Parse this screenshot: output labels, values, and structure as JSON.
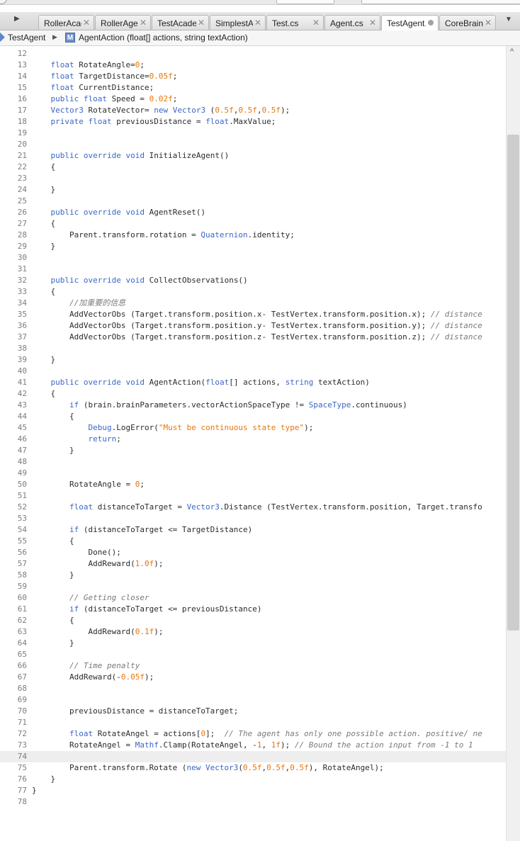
{
  "window": {
    "tabs": [
      {
        "label": "RollerAcad",
        "state": "close"
      },
      {
        "label": "RollerAger",
        "state": "close"
      },
      {
        "label": "TestAcader",
        "state": "close"
      },
      {
        "label": "SimplestAg",
        "state": "close"
      },
      {
        "label": "Test.cs",
        "state": "close"
      },
      {
        "label": "Agent.cs",
        "state": "close"
      },
      {
        "label": "TestAgent.",
        "state": "modified",
        "active": true
      },
      {
        "label": "CoreBrainI",
        "state": "close"
      }
    ],
    "close_glyph": "✕",
    "tab_left_arrow": "▶",
    "tab_dropdown": "▼"
  },
  "breadcrumb": {
    "class_name": "TestAgent",
    "separator": "▶",
    "member_icon_letter": "M",
    "member": "AgentAction (float[] actions, string textAction)"
  },
  "editor": {
    "current_line": 74,
    "lines": [
      {
        "n": "12",
        "t": ""
      },
      {
        "n": "13",
        "t": "    float RotateAngle=0;"
      },
      {
        "n": "14",
        "t": "    float TargetDistance=0.05f;"
      },
      {
        "n": "15",
        "t": "    float CurrentDistance;"
      },
      {
        "n": "16",
        "t": "    public float Speed = 0.02f;"
      },
      {
        "n": "17",
        "t": "    Vector3 RotateVector= new Vector3 (0.5f,0.5f,0.5f);"
      },
      {
        "n": "18",
        "t": "    private float previousDistance = float.MaxValue;"
      },
      {
        "n": "19",
        "t": ""
      },
      {
        "n": "20",
        "t": ""
      },
      {
        "n": "21",
        "t": "    public override void InitializeAgent()"
      },
      {
        "n": "22",
        "t": "    {"
      },
      {
        "n": "23",
        "t": ""
      },
      {
        "n": "24",
        "t": "    }"
      },
      {
        "n": "25",
        "t": ""
      },
      {
        "n": "26",
        "t": "    public override void AgentReset()"
      },
      {
        "n": "27",
        "t": "    {"
      },
      {
        "n": "28",
        "t": "        Parent.transform.rotation = Quaternion.identity;"
      },
      {
        "n": "29",
        "t": "    }"
      },
      {
        "n": "30",
        "t": ""
      },
      {
        "n": "31",
        "t": ""
      },
      {
        "n": "32",
        "t": "    public override void CollectObservations()"
      },
      {
        "n": "33",
        "t": "    {"
      },
      {
        "n": "34",
        "t": "        //加重要的信息"
      },
      {
        "n": "35",
        "t": "        AddVectorObs (Target.transform.position.x- TestVertex.transform.position.x); // distance"
      },
      {
        "n": "36",
        "t": "        AddVectorObs (Target.transform.position.y- TestVertex.transform.position.y); // distance"
      },
      {
        "n": "37",
        "t": "        AddVectorObs (Target.transform.position.z- TestVertex.transform.position.z); // distance"
      },
      {
        "n": "38",
        "t": ""
      },
      {
        "n": "39",
        "t": "    }"
      },
      {
        "n": "40",
        "t": ""
      },
      {
        "n": "41",
        "t": "    public override void AgentAction(float[] actions, string textAction)"
      },
      {
        "n": "42",
        "t": "    {"
      },
      {
        "n": "43",
        "t": "        if (brain.brainParameters.vectorActionSpaceType != SpaceType.continuous)"
      },
      {
        "n": "44",
        "t": "        {"
      },
      {
        "n": "45",
        "t": "            Debug.LogError(\"Must be continuous state type\");"
      },
      {
        "n": "46",
        "t": "            return;"
      },
      {
        "n": "47",
        "t": "        }"
      },
      {
        "n": "48",
        "t": ""
      },
      {
        "n": "49",
        "t": ""
      },
      {
        "n": "50",
        "t": "        RotateAngle = 0;"
      },
      {
        "n": "51",
        "t": ""
      },
      {
        "n": "52",
        "t": "        float distanceToTarget = Vector3.Distance (TestVertex.transform.position, Target.transfo"
      },
      {
        "n": "53",
        "t": ""
      },
      {
        "n": "54",
        "t": "        if (distanceToTarget <= TargetDistance)"
      },
      {
        "n": "55",
        "t": "        {"
      },
      {
        "n": "56",
        "t": "            Done();"
      },
      {
        "n": "57",
        "t": "            AddReward(1.0f);"
      },
      {
        "n": "58",
        "t": "        }"
      },
      {
        "n": "59",
        "t": ""
      },
      {
        "n": "60",
        "t": "        // Getting closer"
      },
      {
        "n": "61",
        "t": "        if (distanceToTarget <= previousDistance)"
      },
      {
        "n": "62",
        "t": "        {"
      },
      {
        "n": "63",
        "t": "            AddReward(0.1f);"
      },
      {
        "n": "64",
        "t": "        }"
      },
      {
        "n": "65",
        "t": ""
      },
      {
        "n": "66",
        "t": "        // Time penalty"
      },
      {
        "n": "67",
        "t": "        AddReward(-0.05f);"
      },
      {
        "n": "68",
        "t": ""
      },
      {
        "n": "69",
        "t": ""
      },
      {
        "n": "70",
        "t": "        previousDistance = distanceToTarget;"
      },
      {
        "n": "71",
        "t": ""
      },
      {
        "n": "72",
        "t": "        float RotateAngel = actions[0];  // The agent has only one possible action. positive/ ne"
      },
      {
        "n": "73",
        "t": "        RotateAngel = Mathf.Clamp(RotateAngel, -1, 1f); // Bound the action input from -1 to 1"
      },
      {
        "n": "74",
        "t": ""
      },
      {
        "n": "75",
        "t": "        Parent.transform.Rotate (new Vector3(0.5f,0.5f,0.5f), RotateAngel);"
      },
      {
        "n": "76",
        "t": "    }"
      },
      {
        "n": "77",
        "t": "}"
      },
      {
        "n": "78",
        "t": ""
      }
    ]
  },
  "scrollbar": {
    "up_glyph": "^"
  },
  "colors": {
    "keyword": "#3a66c6",
    "number": "#e8760c",
    "comment": "#7a7a7a",
    "line_number": "#7d7d7d"
  }
}
